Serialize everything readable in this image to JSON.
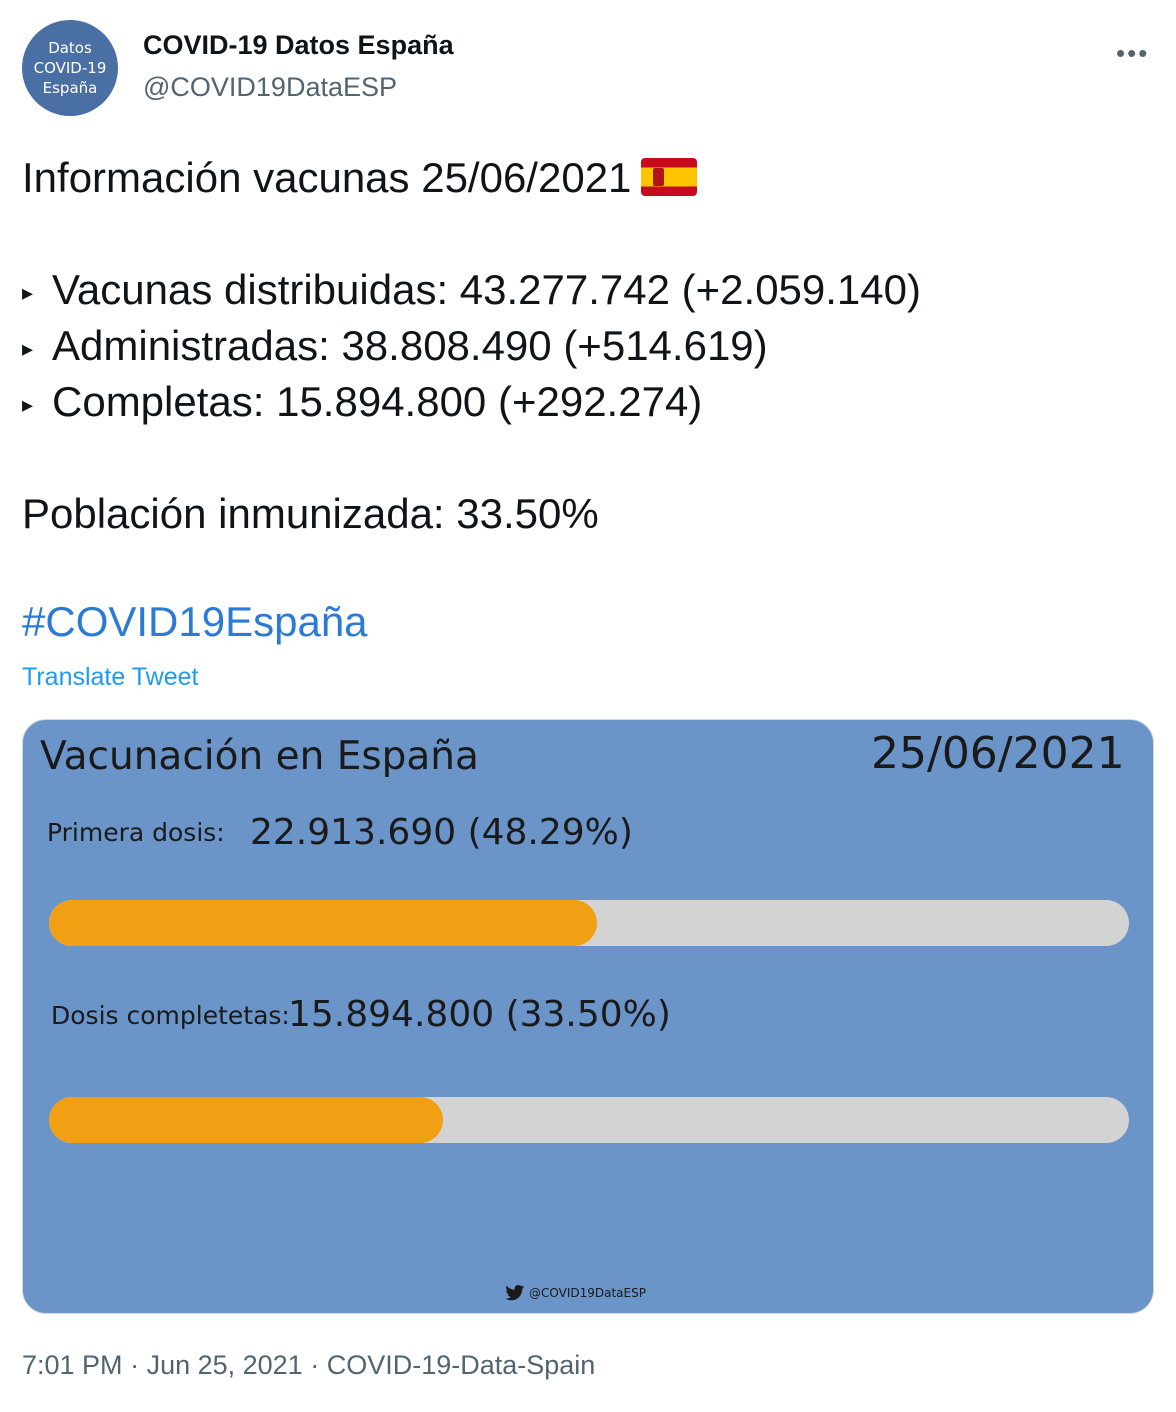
{
  "author": {
    "avatar_lines": [
      "Datos",
      "COVID-19",
      "España"
    ],
    "display_name": "COVID-19 Datos España",
    "handle": "@COVID19DataESP"
  },
  "tweet": {
    "heading": "Información vacunas 25/06/2021",
    "flag_icon": "spain-flag-icon",
    "stats": [
      "Vacunas distribuidas: 43.277.742 (+2.059.140)",
      "Administradas: 38.808.490 (+514.619)",
      "Completas: 15.894.800 (+292.274)"
    ],
    "bullet": "▸",
    "immunized": "Población inmunizada: 33.50%",
    "hashtag": "#COVID19España",
    "translate": "Translate Tweet"
  },
  "card": {
    "title": "Vacunación en España",
    "date": "25/06/2021",
    "first_dose_label": "Primera dosis:",
    "first_dose_value": "22.913.690 (48.29%)",
    "first_dose_progress": 0.507,
    "complete_label": "Dosis completetas:",
    "complete_value": "15.894.800 (33.50%)",
    "complete_progress": 0.365,
    "watermark": "@COVID19DataESP",
    "colors": {
      "background": "#6b94c8",
      "bar_fill": "#f0a012",
      "bar_track": "#d3d3d3"
    }
  },
  "footer": {
    "time": "7:01 PM",
    "date": "Jun 25, 2021",
    "source": "COVID-19-Data-Spain",
    "separator": " · "
  },
  "more_icon": "more-options-icon"
}
